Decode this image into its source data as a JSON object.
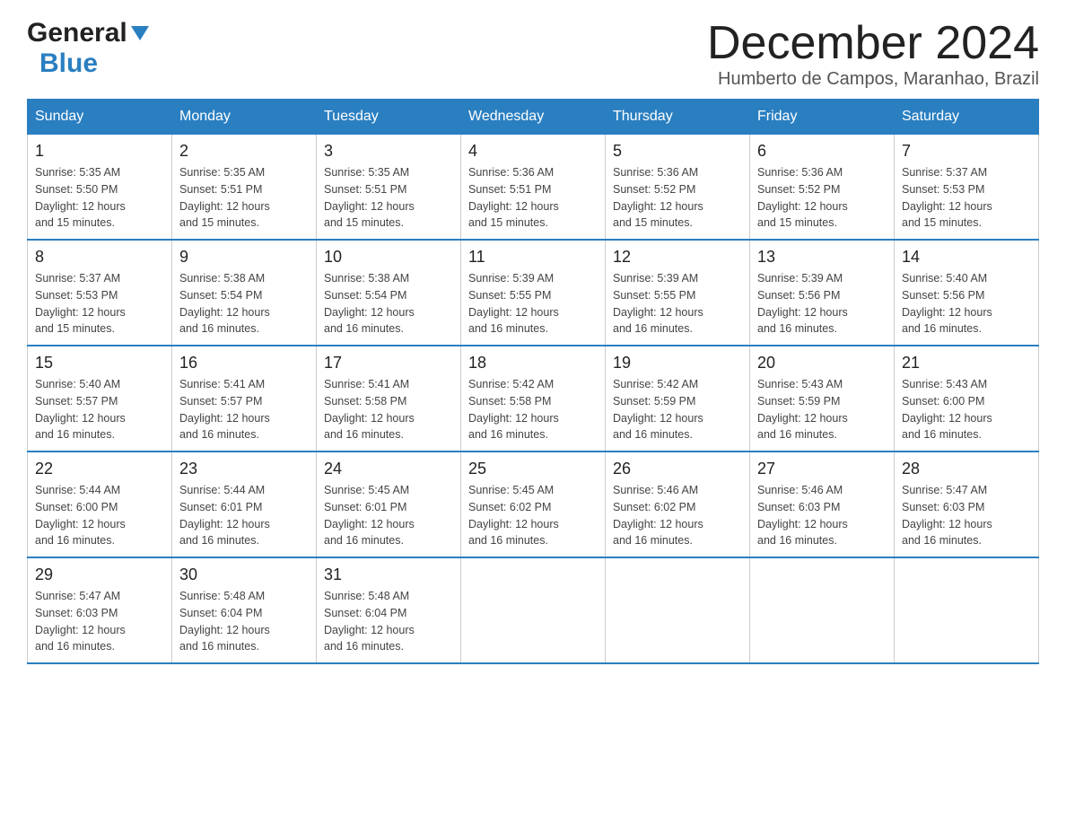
{
  "logo": {
    "general": "General",
    "blue": "Blue",
    "triangle": "▲"
  },
  "title": "December 2024",
  "subtitle": "Humberto de Campos, Maranhao, Brazil",
  "weekdays": [
    "Sunday",
    "Monday",
    "Tuesday",
    "Wednesday",
    "Thursday",
    "Friday",
    "Saturday"
  ],
  "weeks": [
    [
      {
        "day": "1",
        "sunrise": "5:35 AM",
        "sunset": "5:50 PM",
        "daylight": "12 hours and 15 minutes."
      },
      {
        "day": "2",
        "sunrise": "5:35 AM",
        "sunset": "5:51 PM",
        "daylight": "12 hours and 15 minutes."
      },
      {
        "day": "3",
        "sunrise": "5:35 AM",
        "sunset": "5:51 PM",
        "daylight": "12 hours and 15 minutes."
      },
      {
        "day": "4",
        "sunrise": "5:36 AM",
        "sunset": "5:51 PM",
        "daylight": "12 hours and 15 minutes."
      },
      {
        "day": "5",
        "sunrise": "5:36 AM",
        "sunset": "5:52 PM",
        "daylight": "12 hours and 15 minutes."
      },
      {
        "day": "6",
        "sunrise": "5:36 AM",
        "sunset": "5:52 PM",
        "daylight": "12 hours and 15 minutes."
      },
      {
        "day": "7",
        "sunrise": "5:37 AM",
        "sunset": "5:53 PM",
        "daylight": "12 hours and 15 minutes."
      }
    ],
    [
      {
        "day": "8",
        "sunrise": "5:37 AM",
        "sunset": "5:53 PM",
        "daylight": "12 hours and 15 minutes."
      },
      {
        "day": "9",
        "sunrise": "5:38 AM",
        "sunset": "5:54 PM",
        "daylight": "12 hours and 16 minutes."
      },
      {
        "day": "10",
        "sunrise": "5:38 AM",
        "sunset": "5:54 PM",
        "daylight": "12 hours and 16 minutes."
      },
      {
        "day": "11",
        "sunrise": "5:39 AM",
        "sunset": "5:55 PM",
        "daylight": "12 hours and 16 minutes."
      },
      {
        "day": "12",
        "sunrise": "5:39 AM",
        "sunset": "5:55 PM",
        "daylight": "12 hours and 16 minutes."
      },
      {
        "day": "13",
        "sunrise": "5:39 AM",
        "sunset": "5:56 PM",
        "daylight": "12 hours and 16 minutes."
      },
      {
        "day": "14",
        "sunrise": "5:40 AM",
        "sunset": "5:56 PM",
        "daylight": "12 hours and 16 minutes."
      }
    ],
    [
      {
        "day": "15",
        "sunrise": "5:40 AM",
        "sunset": "5:57 PM",
        "daylight": "12 hours and 16 minutes."
      },
      {
        "day": "16",
        "sunrise": "5:41 AM",
        "sunset": "5:57 PM",
        "daylight": "12 hours and 16 minutes."
      },
      {
        "day": "17",
        "sunrise": "5:41 AM",
        "sunset": "5:58 PM",
        "daylight": "12 hours and 16 minutes."
      },
      {
        "day": "18",
        "sunrise": "5:42 AM",
        "sunset": "5:58 PM",
        "daylight": "12 hours and 16 minutes."
      },
      {
        "day": "19",
        "sunrise": "5:42 AM",
        "sunset": "5:59 PM",
        "daylight": "12 hours and 16 minutes."
      },
      {
        "day": "20",
        "sunrise": "5:43 AM",
        "sunset": "5:59 PM",
        "daylight": "12 hours and 16 minutes."
      },
      {
        "day": "21",
        "sunrise": "5:43 AM",
        "sunset": "6:00 PM",
        "daylight": "12 hours and 16 minutes."
      }
    ],
    [
      {
        "day": "22",
        "sunrise": "5:44 AM",
        "sunset": "6:00 PM",
        "daylight": "12 hours and 16 minutes."
      },
      {
        "day": "23",
        "sunrise": "5:44 AM",
        "sunset": "6:01 PM",
        "daylight": "12 hours and 16 minutes."
      },
      {
        "day": "24",
        "sunrise": "5:45 AM",
        "sunset": "6:01 PM",
        "daylight": "12 hours and 16 minutes."
      },
      {
        "day": "25",
        "sunrise": "5:45 AM",
        "sunset": "6:02 PM",
        "daylight": "12 hours and 16 minutes."
      },
      {
        "day": "26",
        "sunrise": "5:46 AM",
        "sunset": "6:02 PM",
        "daylight": "12 hours and 16 minutes."
      },
      {
        "day": "27",
        "sunrise": "5:46 AM",
        "sunset": "6:03 PM",
        "daylight": "12 hours and 16 minutes."
      },
      {
        "day": "28",
        "sunrise": "5:47 AM",
        "sunset": "6:03 PM",
        "daylight": "12 hours and 16 minutes."
      }
    ],
    [
      {
        "day": "29",
        "sunrise": "5:47 AM",
        "sunset": "6:03 PM",
        "daylight": "12 hours and 16 minutes."
      },
      {
        "day": "30",
        "sunrise": "5:48 AM",
        "sunset": "6:04 PM",
        "daylight": "12 hours and 16 minutes."
      },
      {
        "day": "31",
        "sunrise": "5:48 AM",
        "sunset": "6:04 PM",
        "daylight": "12 hours and 16 minutes."
      },
      null,
      null,
      null,
      null
    ]
  ],
  "labels": {
    "sunrise": "Sunrise:",
    "sunset": "Sunset:",
    "daylight": "Daylight:"
  }
}
